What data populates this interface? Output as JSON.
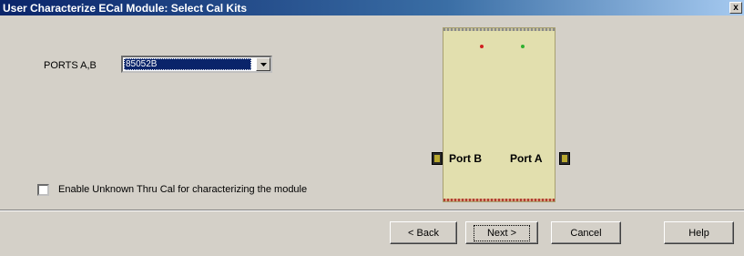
{
  "window": {
    "title": "User Characterize ECal Module: Select Cal Kits",
    "close_label": "x"
  },
  "ports": {
    "label": "PORTS A,B",
    "selected_value": "85052B"
  },
  "module": {
    "port_b_label": "Port B",
    "port_a_label": "Port A"
  },
  "options": {
    "unknown_thru_label": "Enable Unknown Thru Cal for characterizing the module",
    "unknown_thru_checked": false
  },
  "buttons": {
    "back": "< Back",
    "next": "Next >",
    "cancel": "Cancel",
    "help": "Help"
  },
  "colors": {
    "title_bar_start": "#0a246a",
    "dialog_bg": "#d4d0c8",
    "module_body": "#e2dfae",
    "led_red": "#d02020",
    "led_green": "#30b030"
  }
}
